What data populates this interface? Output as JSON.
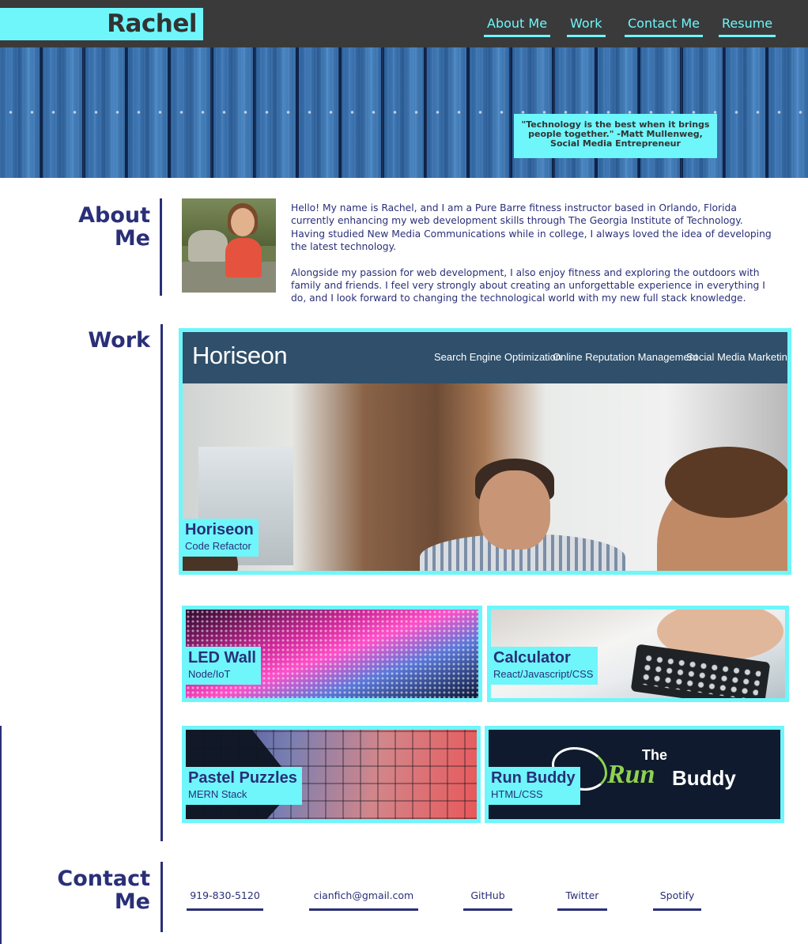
{
  "header": {
    "brand": "Rachel",
    "nav": [
      "About Me",
      "Work",
      "Contact Me",
      "Resume"
    ]
  },
  "hero": {
    "quote": "\"Technology is the best when it brings people together.\" -Matt Mullenweg, Social Media Entrepreneur"
  },
  "about": {
    "title": "About Me",
    "paragraphs": [
      "Hello! My name is Rachel, and I am a Pure Barre fitness instructor based in Orlando, Florida currently enhancing my web development skills through The Georgia Institute of Technology. Having studied New Media Communications while in college, I always loved the idea of developing the latest technology.",
      "Alongside my passion for web development, I also enjoy fitness and exploring the outdoors with family and friends. I feel very strongly about creating an unforgettable experience in everything I do, and I look forward to changing the technological world with my new full stack knowledge."
    ]
  },
  "work": {
    "title": "Work",
    "projects": [
      {
        "title": "Horiseon",
        "subtitle": "Code Refactor"
      },
      {
        "title": "LED Wall",
        "subtitle": "Node/IoT"
      },
      {
        "title": "Calculator",
        "subtitle": "React/Javascript/CSS"
      },
      {
        "title": "Pastel Puzzles",
        "subtitle": "MERN Stack"
      },
      {
        "title": "Run Buddy",
        "subtitle": "HTML/CSS"
      }
    ],
    "horiseon_screenshot": {
      "logo": "Horiseon",
      "nav": [
        "Search Engine Optimization",
        "Online Reputation Management",
        "Social Media Marketing"
      ]
    },
    "runbuddy_logo": {
      "the": "The",
      "run": "Run",
      "buddy": "Buddy"
    }
  },
  "contact": {
    "title": "Contact Me",
    "links": [
      "919-830-5120",
      "cianfich@gmail.com",
      "GitHub",
      "Twitter",
      "Spotify"
    ]
  },
  "colors": {
    "accent": "#6ef6fb",
    "text": "#2a2f78",
    "header_bg": "#3a3a3a"
  }
}
